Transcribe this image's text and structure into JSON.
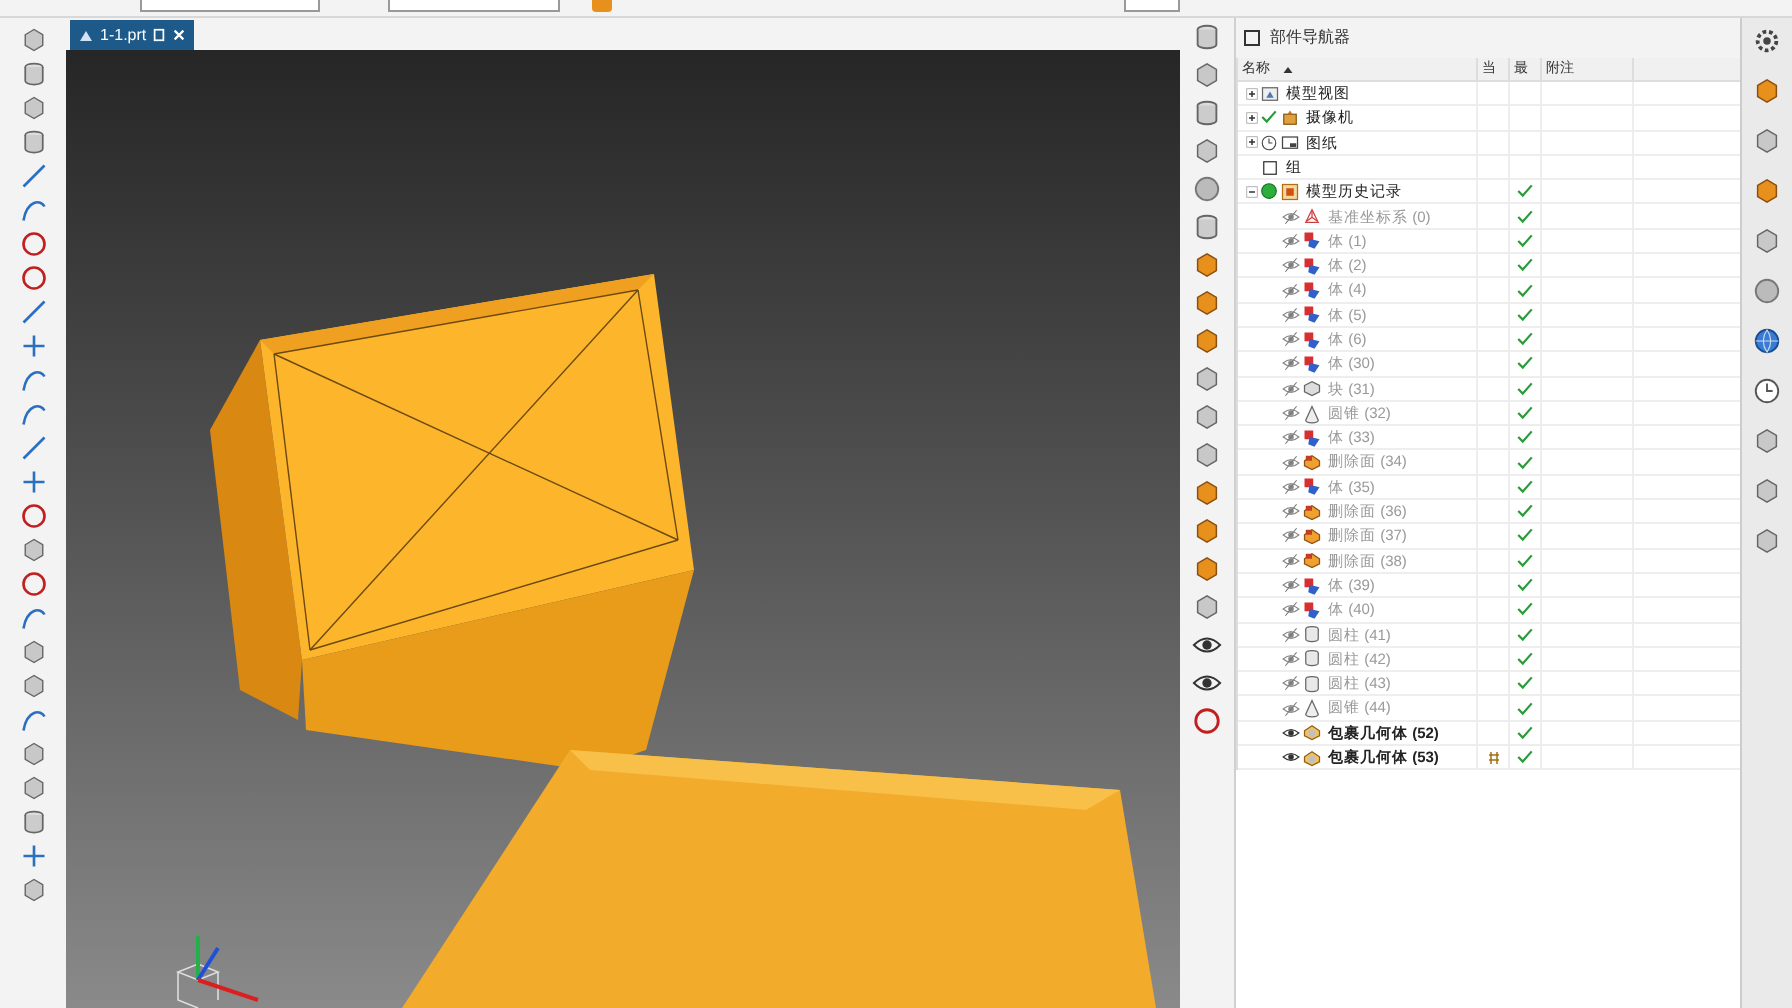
{
  "tabs": [
    {
      "label": "1-1.prt",
      "selected": true
    }
  ],
  "navigator": {
    "title": "部件导航器",
    "columns": [
      "名称",
      "当",
      "最",
      "附注"
    ],
    "nodes": [
      {
        "label": "模型视图",
        "kind": "view",
        "expanded": false
      },
      {
        "label": "摄像机",
        "kind": "camera",
        "expanded": false
      },
      {
        "label": "图纸",
        "kind": "drawing",
        "expanded": false
      },
      {
        "label": "组",
        "kind": "group"
      },
      {
        "label": "模型历史记录",
        "kind": "history",
        "expanded": true,
        "latest": true,
        "children": [
          {
            "label": "基准坐标系 (0)",
            "kind": "datum",
            "shown": false,
            "latest": true,
            "current": false
          },
          {
            "label": "体 (1)",
            "kind": "body",
            "shown": false,
            "latest": true,
            "current": false
          },
          {
            "label": "体 (2)",
            "kind": "body",
            "shown": false,
            "latest": true,
            "current": false
          },
          {
            "label": "体 (4)",
            "kind": "body",
            "shown": false,
            "latest": true,
            "current": false
          },
          {
            "label": "体 (5)",
            "kind": "body",
            "shown": false,
            "latest": true,
            "current": false
          },
          {
            "label": "体 (6)",
            "kind": "body",
            "shown": false,
            "latest": true,
            "current": false
          },
          {
            "label": "体 (30)",
            "kind": "body",
            "shown": false,
            "latest": true,
            "current": false
          },
          {
            "label": "块 (31)",
            "kind": "block",
            "shown": false,
            "latest": true,
            "current": false
          },
          {
            "label": "圆锥 (32)",
            "kind": "cone",
            "shown": false,
            "latest": true,
            "current": false
          },
          {
            "label": "体 (33)",
            "kind": "body",
            "shown": false,
            "latest": true,
            "current": false
          },
          {
            "label": "删除面 (34)",
            "kind": "delete",
            "shown": false,
            "latest": true,
            "current": false
          },
          {
            "label": "体 (35)",
            "kind": "body",
            "shown": false,
            "latest": true,
            "current": false
          },
          {
            "label": "删除面 (36)",
            "kind": "delete",
            "shown": false,
            "latest": true,
            "current": false
          },
          {
            "label": "删除面 (37)",
            "kind": "delete",
            "shown": false,
            "latest": true,
            "current": false
          },
          {
            "label": "删除面 (38)",
            "kind": "delete",
            "shown": false,
            "latest": true,
            "current": false
          },
          {
            "label": "体 (39)",
            "kind": "body",
            "shown": false,
            "latest": true,
            "current": false
          },
          {
            "label": "体 (40)",
            "kind": "body",
            "shown": false,
            "latest": true,
            "current": false
          },
          {
            "label": "圆柱 (41)",
            "kind": "cylinder",
            "shown": false,
            "latest": true,
            "current": false
          },
          {
            "label": "圆柱 (42)",
            "kind": "cylinder",
            "shown": false,
            "latest": true,
            "current": false
          },
          {
            "label": "圆柱 (43)",
            "kind": "cylinder",
            "shown": false,
            "latest": true,
            "current": false
          },
          {
            "label": "圆锥 (44)",
            "kind": "cone",
            "shown": false,
            "latest": true,
            "current": false
          },
          {
            "label": "包裹几何体 (52)",
            "kind": "wrap",
            "shown": true,
            "latest": true,
            "current": false
          },
          {
            "label": "包裹几何体 (53)",
            "kind": "wrap",
            "shown": true,
            "latest": true,
            "current": true
          }
        ]
      }
    ]
  }
}
